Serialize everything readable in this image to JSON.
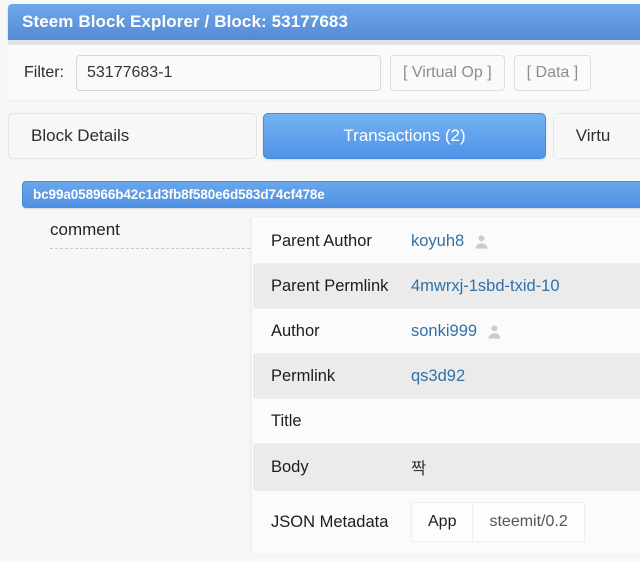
{
  "window": {
    "title": "Steem Block Explorer / Block: 53177683"
  },
  "filter": {
    "label": "Filter:",
    "value": "53177683-1",
    "placeholder": "",
    "virtual_op_button": "[ Virtual Op ]",
    "data_button": "[ Data ]"
  },
  "tabs": [
    {
      "label": "Block Details",
      "active": false
    },
    {
      "label": "Transactions (2)",
      "active": true
    },
    {
      "label": "Virtu",
      "active": false
    }
  ],
  "transaction": {
    "hash": "bc99a058966b42c1d3fb8f580e6d583d74cf478e",
    "operation_name": "comment"
  },
  "details": {
    "rows": [
      {
        "key": "Parent Author",
        "value": "koyuh8",
        "link": true,
        "avatar": true
      },
      {
        "key": "Parent Permlink",
        "value": "4mwrxj-1sbd-txid-10",
        "link": true,
        "avatar": false
      },
      {
        "key": "Author",
        "value": "sonki999",
        "link": true,
        "avatar": true
      },
      {
        "key": "Permlink",
        "value": "qs3d92",
        "link": true,
        "avatar": false
      },
      {
        "key": "Title",
        "value": "",
        "link": false,
        "avatar": false
      },
      {
        "key": "Body",
        "value": "짝",
        "link": false,
        "avatar": false
      }
    ],
    "json_metadata": {
      "key": "JSON Metadata",
      "nested_key": "App",
      "nested_value": "steemit/0.2"
    }
  },
  "colors": {
    "titlebar_top": "#6ea8e8",
    "titlebar_bottom": "#558ad6",
    "tab_active_top": "#73b2f2",
    "tab_active_bottom": "#4e93e8",
    "link": "#3071a9",
    "row_alt": "#ebebeb"
  }
}
